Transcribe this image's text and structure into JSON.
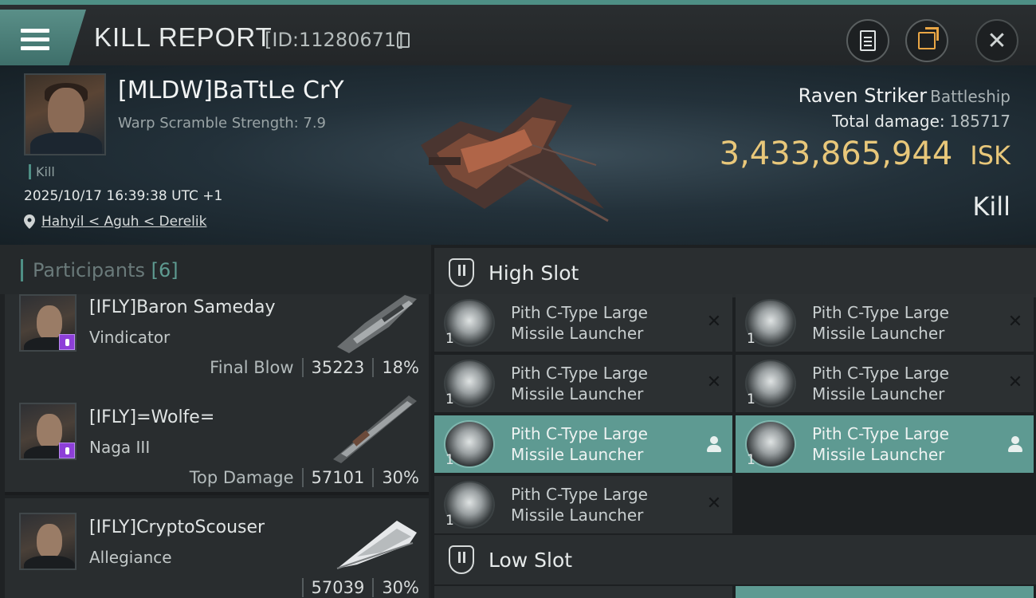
{
  "header": {
    "title": "KILL REPORT",
    "id_text": "[ID:11280671]"
  },
  "victim": {
    "pilot": "[MLDW]BaTtLe CrY",
    "warp_scramble": "Warp Scramble Strength: 7.9",
    "kill_tag": "Kill",
    "datetime": "2025/10/17 16:39:38 UTC +1",
    "location": "Hahyil < Aguh < Derelik",
    "ship_name": "Raven Striker",
    "ship_class": "Battleship",
    "total_damage_label": "Total damage:",
    "total_damage": "185717",
    "isk_value": "3,433,865,944",
    "isk_unit": "ISK",
    "result": "Kill"
  },
  "participants": {
    "title": "Participants",
    "count": "[6]",
    "list": [
      {
        "name": "[IFLY]Baron Sameday",
        "ship": "Vindicator",
        "role": "Final Blow",
        "damage": "35223",
        "percent": "18%"
      },
      {
        "name": "[IFLY]=Wolfe=",
        "ship": "Naga III",
        "role": "Top Damage",
        "damage": "57101",
        "percent": "30%"
      },
      {
        "name": "[IFLY]CryptoScouser",
        "ship": "Allegiance",
        "role": "",
        "damage": "57039",
        "percent": "30%"
      }
    ]
  },
  "fitting": {
    "high_slot_title": "High Slot",
    "low_slot_title": "Low Slot",
    "high_slot": [
      {
        "line1": "Pith C-Type Large",
        "line2": "Missile Launcher",
        "qty": "1",
        "status": "destroyed"
      },
      {
        "line1": "Pith C-Type Large",
        "line2": "Missile Launcher",
        "qty": "1",
        "status": "destroyed"
      },
      {
        "line1": "Pith C-Type Large",
        "line2": "Missile Launcher",
        "qty": "1",
        "status": "destroyed"
      },
      {
        "line1": "Pith C-Type Large",
        "line2": "Missile Launcher",
        "qty": "1",
        "status": "destroyed"
      },
      {
        "line1": "Pith C-Type Large",
        "line2": "Missile Launcher",
        "qty": "1",
        "status": "dropped"
      },
      {
        "line1": "Pith C-Type Large",
        "line2": "Missile Launcher",
        "qty": "1",
        "status": "dropped"
      },
      {
        "line1": "Pith C-Type Large",
        "line2": "Missile Launcher",
        "qty": "1",
        "status": "destroyed"
      }
    ]
  },
  "colors": {
    "accent": "#4e8f85",
    "isk": "#e8c77a",
    "dropped_bg": "#5e9a92",
    "badge": "#8d3fd8"
  }
}
